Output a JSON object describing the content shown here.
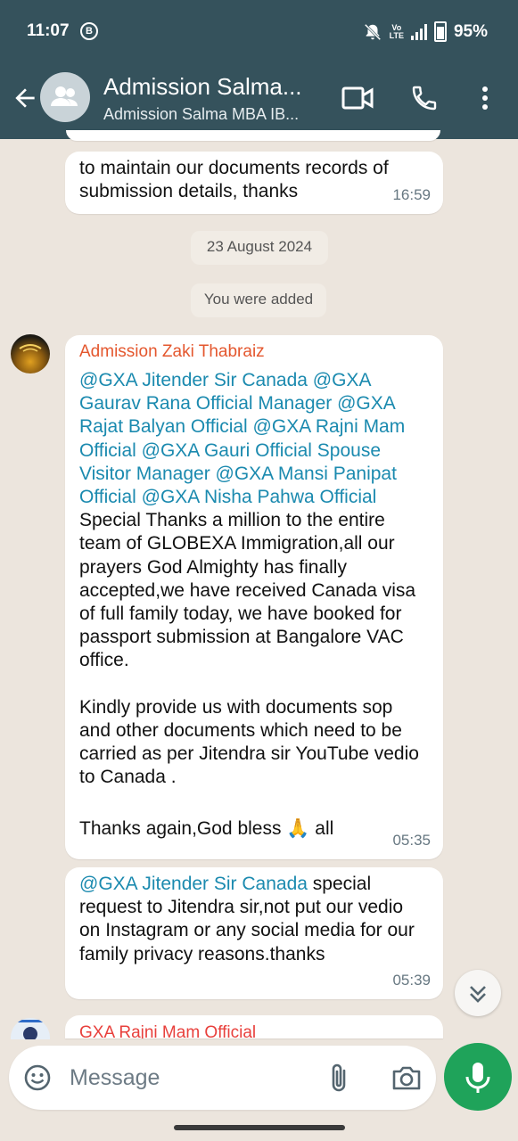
{
  "status_bar": {
    "time": "11:07",
    "b_icon": "B",
    "battery": "95%",
    "icons": [
      "mute-icon",
      "volte-icon",
      "5g-signal-icon",
      "battery-icon"
    ]
  },
  "header": {
    "title": "Admission Salma...",
    "subtitle": "Admission Salma MBA IB...",
    "icons": [
      "back-arrow-icon",
      "group-avatar-icon",
      "video-call-icon",
      "phone-icon",
      "more-icon"
    ]
  },
  "messages": [
    {
      "text": "to maintain our documents records of submission details, thanks",
      "time": "16:59"
    }
  ],
  "date_chip": "23 August 2024",
  "system_notice": "You were added",
  "zaki_message": {
    "sender": "Admission Zaki Thabraiz",
    "mentions": "@GXA Jitender Sir Canada @GXA Gaurav Rana Official Manager @GXA Rajat Balyan Official @GXA Rajni Mam Official @GXA Gauri Official Spouse Visitor Manager @GXA Mansi Panipat Official @GXA Nisha Pahwa Official",
    "paragraph1": "Special Thanks a million to the entire team of GLOBEXA Immigration,all our prayers God Almighty has finally accepted,we have received Canada visa of full family today, we have booked for passport submission at Bangalore VAC office.",
    "paragraph2": "Kindly provide us with documents sop and other documents which need to be carried as per Jitendra sir YouTube vedio to Canada .",
    "paragraph3_pre": "Thanks again,God bless ",
    "emoji": "🙏",
    "paragraph3_post": " all",
    "time": "05:35"
  },
  "zaki_message2": {
    "mention": "@GXA Jitender Sir Canada",
    "text": " special request to Jitendra sir,not put our  vedio on Instagram or any social media for our family privacy reasons.thanks",
    "time": "05:39"
  },
  "next_sender": "GXA Rajni Mam Official",
  "composer": {
    "placeholder": "Message",
    "icons": [
      "emoji-icon",
      "attach-icon",
      "camera-icon",
      "mic-icon"
    ]
  }
}
